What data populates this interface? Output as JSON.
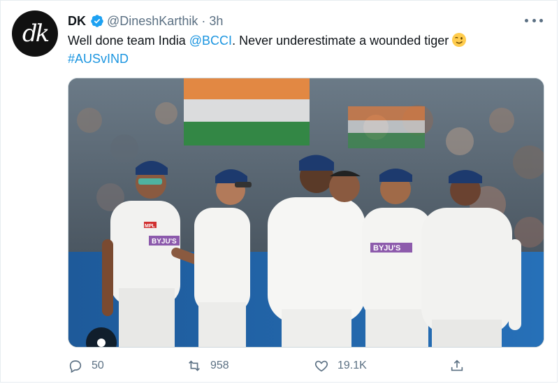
{
  "tweet": {
    "avatar_text": "dk",
    "display_name": "DK",
    "handle": "@DineshKarthik",
    "separator": "·",
    "time": "3h",
    "text_before": "Well done team India ",
    "mention": "@BCCI",
    "text_after": ". Never underestimate a wounded tiger",
    "emoji": "winking-face",
    "hashtag": "#AUSvIND"
  },
  "media": {
    "description_icon": "photo",
    "jersey_brand": "BYJU'S",
    "jersey_sponsor": "MPL"
  },
  "actions": {
    "replies": "50",
    "retweets": "958",
    "likes": "19.1K"
  },
  "colors": {
    "link": "#1b95e0",
    "verified": "#1da1f2",
    "muted": "#5b7083"
  }
}
